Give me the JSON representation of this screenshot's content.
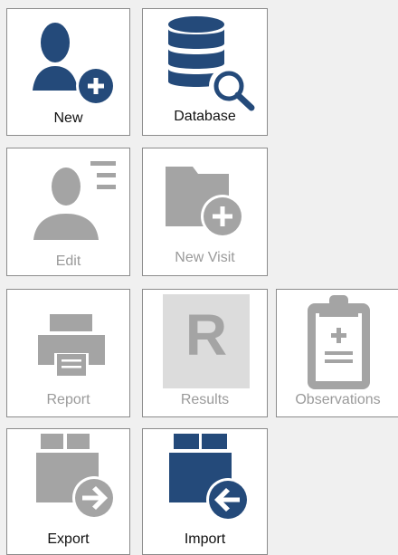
{
  "colors": {
    "enabled_icon": "#244a7a",
    "disabled_icon": "#a4a4a4",
    "enabled_text": "#111111",
    "disabled_text": "#9a9a9a",
    "tile_border": "#8c8c8c",
    "background": "#f0f0f0"
  },
  "tiles": {
    "new": {
      "label": "New",
      "icon": "user-add-icon",
      "enabled": true
    },
    "database": {
      "label": "Database",
      "icon": "database-search-icon",
      "enabled": true
    },
    "edit": {
      "label": "Edit",
      "icon": "user-edit-icon",
      "enabled": false
    },
    "new_visit": {
      "label": "New Visit",
      "icon": "folder-add-icon",
      "enabled": false
    },
    "report": {
      "label": "Report",
      "icon": "printer-icon",
      "enabled": false
    },
    "results": {
      "label": "Results",
      "icon": "results-r-icon",
      "icon_letter": "R",
      "enabled": false
    },
    "observations": {
      "label": "Observations",
      "icon": "clipboard-medical-icon",
      "enabled": false
    },
    "export": {
      "label": "Export",
      "icon": "box-export-icon",
      "enabled": true
    },
    "import": {
      "label": "Import",
      "icon": "box-import-icon",
      "enabled": true
    }
  }
}
